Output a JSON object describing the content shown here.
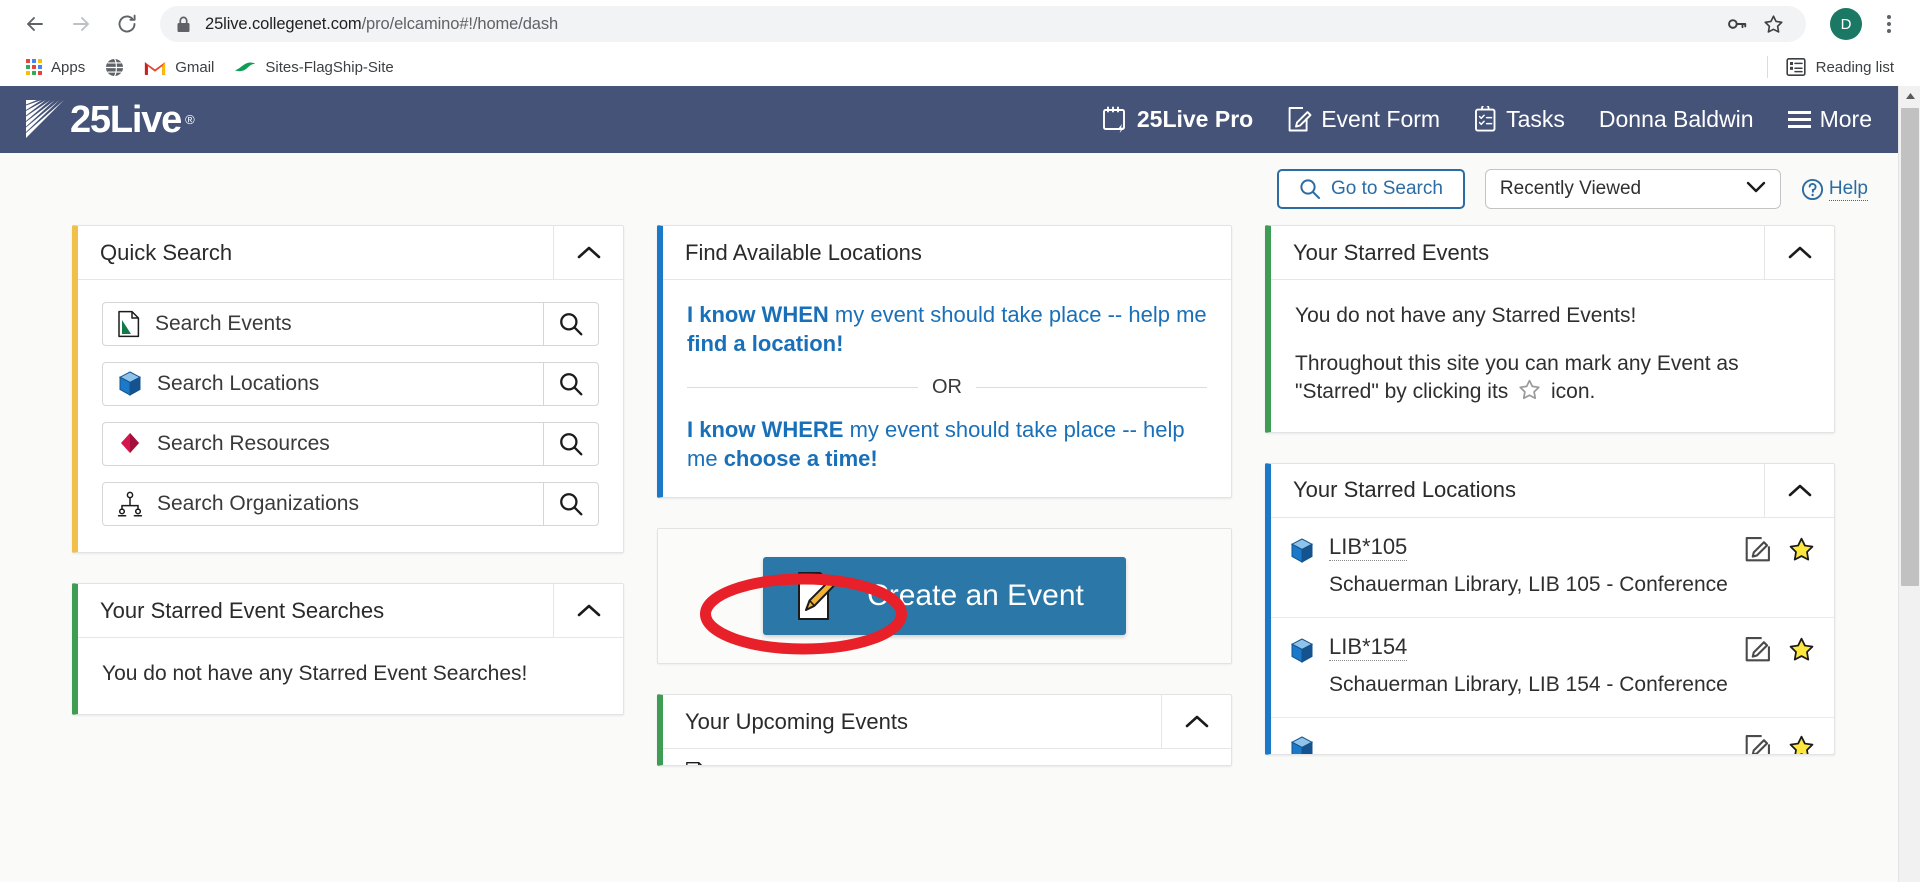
{
  "browser": {
    "back_icon": "back-arrow-icon",
    "forward_icon": "forward-arrow-icon",
    "reload_icon": "reload-icon",
    "lock_icon": "lock-icon",
    "url_host": "25live.collegenet.com",
    "url_path": "/pro/elcamino#!/home/dash",
    "url_full": "25live.collegenet.com/pro/elcamino#!/home/dash",
    "password_key_icon": "key-icon",
    "bookmark_star_icon": "star-outline-icon",
    "profile_initial": "D",
    "menu_icon": "three-dot-menu-icon",
    "bookmarks": [
      {
        "label": "Apps",
        "icon": "apps-grid-icon"
      },
      {
        "label": "",
        "icon": "globe-icon"
      },
      {
        "label": "Gmail",
        "icon": "gmail-icon"
      },
      {
        "label": "Sites-FlagShip-Site",
        "icon": "sites-icon"
      }
    ],
    "reading_list": {
      "label": "Reading list",
      "icon": "reading-list-icon"
    }
  },
  "app_header": {
    "logo_text": "25Live",
    "logo_registered": "®",
    "logo_icon": "sunburst-logo-icon",
    "nav": [
      {
        "label": "25Live Pro",
        "icon": "calendar-bolt-icon",
        "bold": true
      },
      {
        "label": "Event Form",
        "icon": "pencil-square-icon",
        "bold": false
      },
      {
        "label": "Tasks",
        "icon": "clipboard-check-icon",
        "bold": false
      },
      {
        "label": "Donna Baldwin",
        "icon": "",
        "bold": false
      },
      {
        "label": "More",
        "icon": "hamburger-icon",
        "bold": false
      }
    ]
  },
  "toolbar": {
    "go_to_search_label": "Go to Search",
    "go_to_search_icon": "search-icon",
    "recently_viewed_value": "Recently Viewed",
    "recently_viewed_chevron": "chevron-down-icon",
    "help_label": "Help",
    "help_icon": "question-circle-icon"
  },
  "quick_search": {
    "title": "Quick Search",
    "collapse_icon": "chevron-up-icon",
    "accent_color": "#f0c04a",
    "rows": [
      {
        "placeholder": "Search Events",
        "icon": "event-document-icon",
        "button_icon": "search-icon"
      },
      {
        "placeholder": "Search Locations",
        "icon": "location-cube-icon",
        "button_icon": "search-icon"
      },
      {
        "placeholder": "Search Resources",
        "icon": "resource-diamond-icon",
        "button_icon": "search-icon"
      },
      {
        "placeholder": "Search Organizations",
        "icon": "organization-tree-icon",
        "button_icon": "search-icon"
      }
    ]
  },
  "starred_event_searches": {
    "title": "Your Starred Event Searches",
    "collapse_icon": "chevron-up-icon",
    "accent_color": "#3f9c53",
    "empty_message": "You do not have any Starred Event Searches!"
  },
  "find_available_locations": {
    "title": "Find Available Locations",
    "accent_color": "#1a7ac7",
    "option_when_lead": "I know WHEN",
    "option_when_mid": " my event should take place -- help me ",
    "option_when_tail": "find a location!",
    "or_label": "OR",
    "option_where_lead": "I know WHERE",
    "option_where_mid": " my event should take place -- help me ",
    "option_where_tail": "choose a time!"
  },
  "create_event": {
    "label": "Create an Event",
    "icon": "pencil-document-icon",
    "color": "#2a77a8"
  },
  "upcoming_events": {
    "title": "Your Upcoming Events",
    "collapse_icon": "chevron-up-icon",
    "accent_color": "#3f9c53"
  },
  "starred_events": {
    "title": "Your Starred Events",
    "collapse_icon": "chevron-up-icon",
    "accent_color": "#3f9c53",
    "empty_message": "You do not have any Starred Events!",
    "hint_before": "Throughout this site you can mark any Event as \"Starred\" by clicking its ",
    "hint_icon": "star-outline-icon",
    "hint_after": " icon."
  },
  "starred_locations": {
    "title": "Your Starred Locations",
    "collapse_icon": "chevron-up-icon",
    "accent_color": "#1a7ac7",
    "items": [
      {
        "code": "LIB*105",
        "description": "Schauerman Library, LIB 105 - Conference",
        "icon": "location-cube-icon",
        "edit_icon": "edit-square-icon",
        "star_icon": "star-filled-icon"
      },
      {
        "code": "LIB*154",
        "description": "Schauerman Library, LIB 154 - Conference",
        "icon": "location-cube-icon",
        "edit_icon": "edit-square-icon",
        "star_icon": "star-filled-icon"
      }
    ]
  },
  "annotation": {
    "type": "red-ellipse-highlight",
    "target": "I know WHERE",
    "color": "#e8202a"
  },
  "scrollbar": {
    "up_arrow_icon": "scroll-up-arrow-icon"
  }
}
